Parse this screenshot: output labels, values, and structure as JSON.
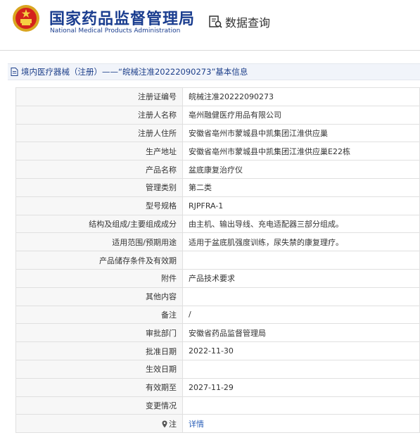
{
  "header": {
    "title_cn": "国家药品监督管理局",
    "title_en": "National Medical Products Administration",
    "query_label": "数据查询",
    "emblem_icon": "national-emblem",
    "query_icon": "search-document-icon",
    "brand_color": "#1a3d8f"
  },
  "breadcrumb": {
    "text": "境内医疗器械（注册）——“皖械注准20222090273”基本信息",
    "icon": "document-icon"
  },
  "records": [
    {
      "label": "注册证编号",
      "value": "皖械注准20222090273"
    },
    {
      "label": "注册人名称",
      "value": "亳州融健医疗用品有限公司"
    },
    {
      "label": "注册人住所",
      "value": "安徽省亳州市蒙城县中凯集团江淮供应巢"
    },
    {
      "label": "生产地址",
      "value": "安徽省亳州市蒙城县中凯集团江淮供应巢E22栋"
    },
    {
      "label": "产品名称",
      "value": "盆底康复治疗仪"
    },
    {
      "label": "管理类别",
      "value": "第二类"
    },
    {
      "label": "型号规格",
      "value": "RJPFRA-1"
    },
    {
      "label": "结构及组成/主要组成成分",
      "value": "由主机、输出导线、充电适配器三部分组成。"
    },
    {
      "label": "适用范围/预期用途",
      "value": "适用于盆底肌强度训练，尿失禁的康复理疗。"
    },
    {
      "label": "产品储存条件及有效期",
      "value": ""
    },
    {
      "label": "附件",
      "value": "产品技术要求"
    },
    {
      "label": "其他内容",
      "value": ""
    },
    {
      "label": "备注",
      "value": "/"
    },
    {
      "label": "审批部门",
      "value": "安徽省药品监督管理局"
    },
    {
      "label": "批准日期",
      "value": "2022-11-30"
    },
    {
      "label": "生效日期",
      "value": ""
    },
    {
      "label": "有效期至",
      "value": "2027-11-29"
    },
    {
      "label": "变更情况",
      "value": ""
    }
  ],
  "note_row": {
    "label": "注",
    "value": "详情",
    "icon": "map-pin-icon"
  }
}
